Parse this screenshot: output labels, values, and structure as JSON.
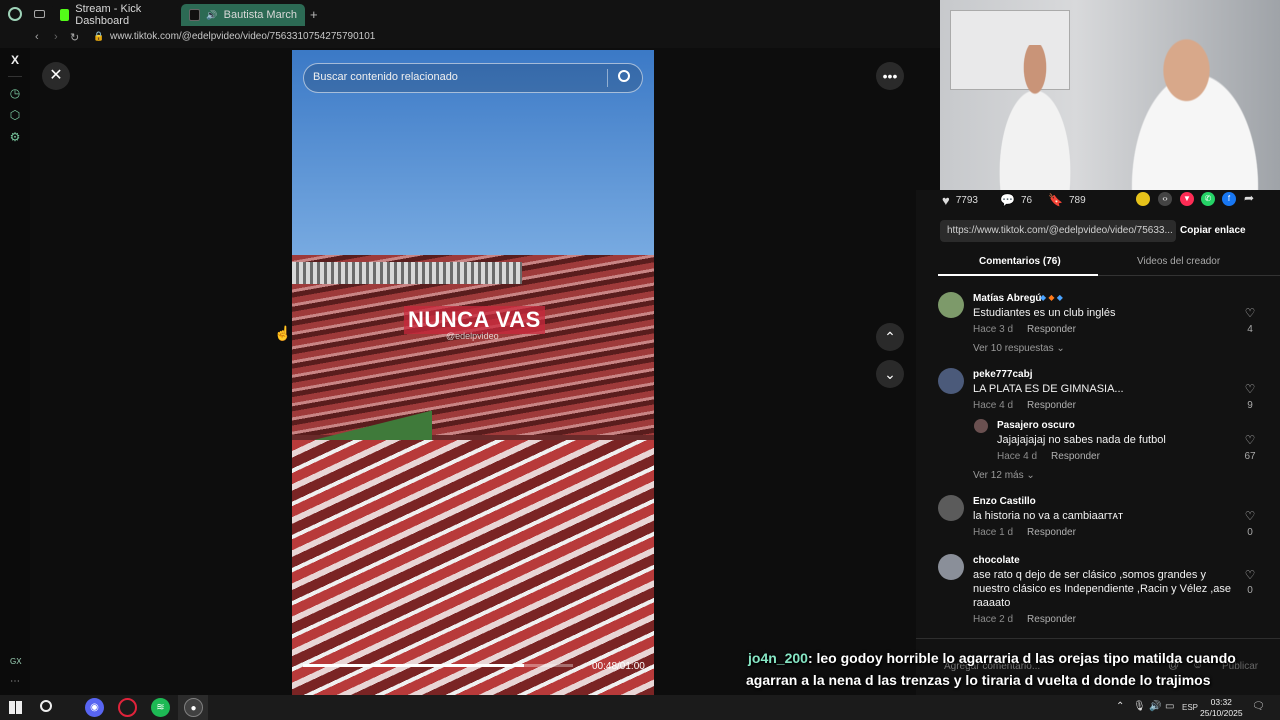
{
  "browser": {
    "tabs": [
      {
        "label": "Stream - Kick Dashboard",
        "favicon_color": "#53fc18"
      },
      {
        "label": "Bautista Marchesini",
        "favicon_color": "#111111"
      }
    ],
    "new_tab_icon": "+",
    "url": "www.tiktok.com/@edelpvideo/video/7563310754275790101",
    "sidebar_bottom_label": "GX"
  },
  "video": {
    "search_placeholder": "Buscar contenido relacionado",
    "overlay_text": "NUNCA VAS",
    "watermark": "@edelpvideo",
    "time": "00:48/01:00",
    "progress": 0.82
  },
  "stats": {
    "likes": "7793",
    "comments": "76",
    "saves": "789"
  },
  "share": {
    "link": "https://www.tiktok.com/@edelpvideo/video/75633...",
    "copy_label": "Copiar enlace"
  },
  "panel_tabs": {
    "comments": "Comentarios (76)",
    "creator_videos": "Videos del creador"
  },
  "comments": [
    {
      "user": "Matías Abregú",
      "text": "Estudiantes es un club inglés",
      "time": "Hace 3 d",
      "reply": "Responder",
      "likes": "4",
      "more": "Ver 10 respuestas",
      "avatar_color": "#7d9a6a"
    },
    {
      "user": "peke777cabj",
      "text": "LA PLATA ES DE GIMNASIA...",
      "time": "Hace 4 d",
      "reply": "Responder",
      "likes": "9",
      "more": "Ver 12 más",
      "avatar_color": "#4b5a7a",
      "sub": {
        "user": "Pasajero oscuro",
        "text": "Jajajajajaj no sabes nada de futbol",
        "time": "Hace 4 d",
        "reply": "Responder",
        "likes": "67",
        "avatar_color": "#6a5050"
      }
    },
    {
      "user": "Enzo Castillo",
      "text": "la historia no va a cambiaarᴛᴀᴛ",
      "time": "Hace 1 d",
      "reply": "Responder",
      "likes": "0",
      "avatar_color": "#5b5b5b"
    },
    {
      "user": "chocolate",
      "text": "ase rato q dejo de ser clásico ,somos grandes y nuestro clásico es Independiente ,Racin y Vélez ,ase raaaato",
      "time": "Hace 2 d",
      "reply": "Responder",
      "likes": "0",
      "avatar_color": "#8a8f99"
    }
  ],
  "comment_input": {
    "placeholder": "Agregar comentario...",
    "publish": "Publicar"
  },
  "chat": {
    "user": "jo4n_200",
    "line1": ": leo godoy horrible lo agarraria d las orejas tipo matilda cuando",
    "line2": "agarran a la nena d las trenzas y lo tiraria d vuelta d donde lo trajimos"
  },
  "taskbar": {
    "language": "ESP",
    "time": "03:32",
    "date": "25/10/2025"
  }
}
